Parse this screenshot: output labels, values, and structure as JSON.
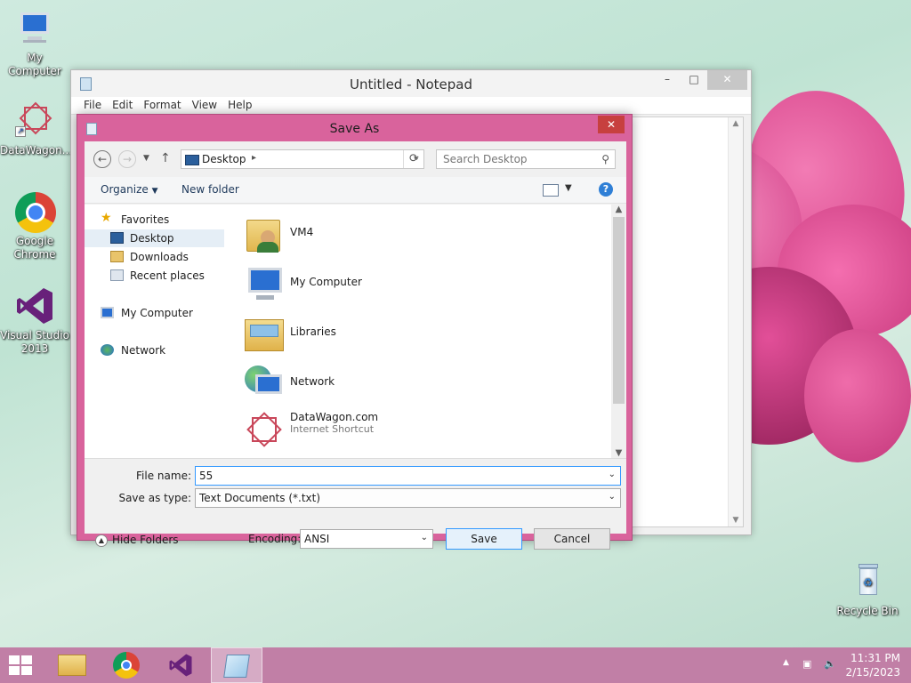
{
  "desktop": {
    "icons": [
      {
        "label": "My Computer"
      },
      {
        "label": "DataWagon..."
      },
      {
        "label": "Google Chrome"
      },
      {
        "label": "Visual Studio 2013"
      },
      {
        "label": "Recycle Bin"
      }
    ]
  },
  "notepad": {
    "title": "Untitled - Notepad",
    "menu": [
      "File",
      "Edit",
      "Format",
      "View",
      "Help"
    ],
    "window_buttons": {
      "minimize": "–",
      "maximize": "□",
      "close": "✕"
    }
  },
  "dialog": {
    "title": "Save As",
    "close": "✕",
    "address": {
      "location": "Desktop"
    },
    "search": {
      "placeholder": "Search Desktop"
    },
    "toolbar": {
      "organize": "Organize",
      "new_folder": "New folder",
      "help": "?"
    },
    "nav": {
      "favorites": "Favorites",
      "items": [
        "Desktop",
        "Downloads",
        "Recent places"
      ],
      "my_computer": "My Computer",
      "network": "Network"
    },
    "files": [
      {
        "name": "VM4",
        "sub": ""
      },
      {
        "name": "My Computer",
        "sub": ""
      },
      {
        "name": "Libraries",
        "sub": ""
      },
      {
        "name": "Network",
        "sub": ""
      },
      {
        "name": "DataWagon.com",
        "sub": "Internet Shortcut"
      }
    ],
    "form": {
      "file_name_label": "File name:",
      "file_name_value": "55",
      "save_type_label": "Save as type:",
      "save_type_value": "Text Documents (*.txt)",
      "encoding_label": "Encoding:",
      "encoding_value": "ANSI",
      "save": "Save",
      "cancel": "Cancel",
      "hide_folders": "Hide Folders"
    }
  },
  "taskbar": {
    "time": "11:31 PM",
    "date": "2/15/2023"
  },
  "colors": {
    "dialog_frame": "#d9639c",
    "taskbar": "#c17fa6",
    "close_red": "#c7403f",
    "accent_blue": "#3399ff"
  }
}
